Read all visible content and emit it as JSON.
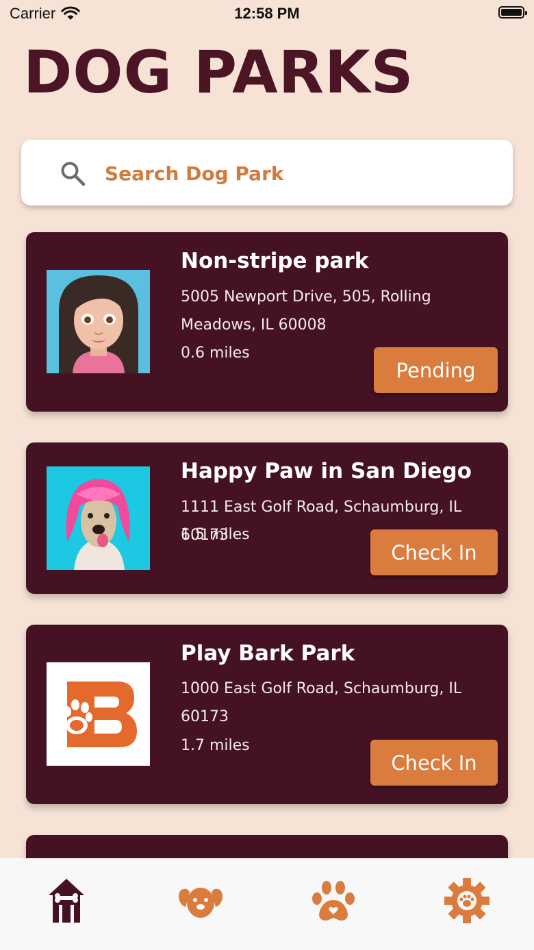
{
  "status": {
    "carrier": "Carrier",
    "time": "12:58 PM"
  },
  "title": "DOG PARKS",
  "search": {
    "placeholder": "Search Dog Park",
    "value": ""
  },
  "parks": [
    {
      "name": "Non-stripe park",
      "address": "5005 Newport Drive, 505, Rolling Meadows, IL 60008",
      "distance": "0.6 miles",
      "action": "Pending",
      "image": "cartoon-avatar"
    },
    {
      "name": "Happy Paw in San Diego",
      "address": "1111 East Golf Road, Schaumburg, IL 60173",
      "distance": "1.5 miles",
      "action": "Check In",
      "image": "pink-wig-dog-photo"
    },
    {
      "name": "Play Bark Park",
      "address": "1000 East Golf Road, Schaumburg, IL 60173",
      "distance": "1.7 miles",
      "action": "Check In",
      "image": "bark-logo"
    }
  ],
  "tabs": [
    {
      "icon": "doghouse-icon",
      "active": true
    },
    {
      "icon": "dog-face-icon",
      "active": false
    },
    {
      "icon": "paw-icon",
      "active": false
    },
    {
      "icon": "gear-paw-icon",
      "active": false
    }
  ],
  "colors": {
    "background": "#f7e3d6",
    "title": "#4b1525",
    "card": "#451223",
    "accent": "#d97c3e"
  }
}
